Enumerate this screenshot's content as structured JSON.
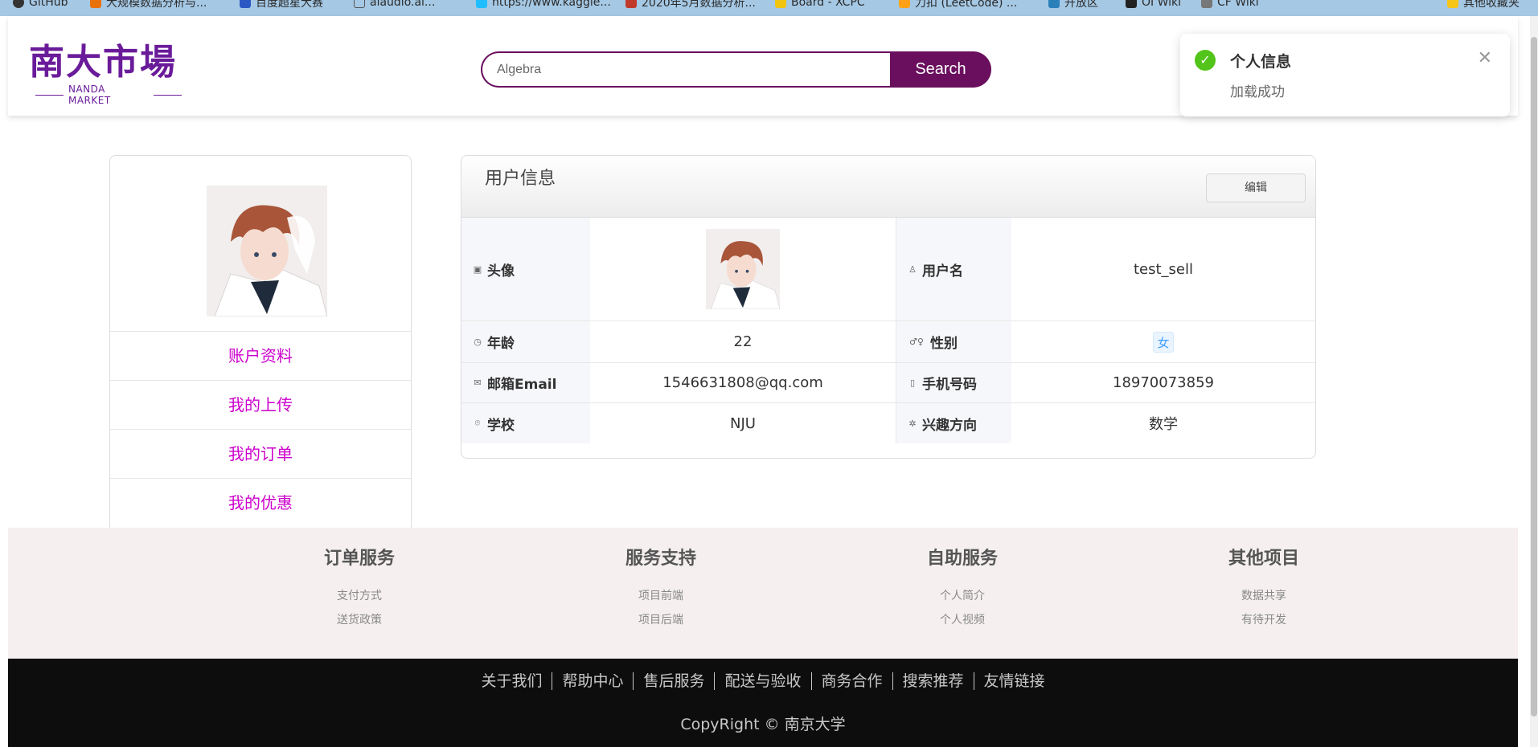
{
  "bookmarks": [
    {
      "label": "GitHub",
      "color": "#333333"
    },
    {
      "label": "大规模数据分析与...",
      "color": "#e8710a"
    },
    {
      "label": "百度超星大赛",
      "color": "#2b59c3"
    },
    {
      "label": "aiaudio.ai...",
      "color": "#555555"
    },
    {
      "label": "https://www.kaggle...",
      "color": "#20beff"
    },
    {
      "label": "2020年5月数据分析...",
      "color": "#c0392b"
    },
    {
      "label": "Board - XCPC",
      "color": "#f1c40f"
    },
    {
      "label": "力扣 (LeetCode) ...",
      "color": "#ffa116"
    },
    {
      "label": "开放区",
      "color": "#2980b9"
    },
    {
      "label": "OI Wiki",
      "color": "#222222"
    },
    {
      "label": "CF Wiki",
      "color": "#777777"
    },
    {
      "label": "其他收藏夹",
      "color": "#f5c518"
    }
  ],
  "header": {
    "logo_main": "南大市場",
    "logo_sub": "NANDA MARKET",
    "search_value": "Algebra",
    "search_button": "Search"
  },
  "notification": {
    "title": "个人信息",
    "message": "加载成功",
    "check_icon": "✓",
    "close_icon": "✕"
  },
  "sidebar": {
    "items": [
      "账户资料",
      "我的上传",
      "我的订单",
      "我的优惠"
    ]
  },
  "user_card": {
    "title": "用户信息",
    "edit_button": "编辑",
    "fields": {
      "avatar_label": "头像",
      "username_label": "用户名",
      "username": "test_sell",
      "age_label": "年龄",
      "age": "22",
      "gender_label": "性别",
      "gender": "女",
      "email_label": "邮箱Email",
      "email": "1546631808@qq.com",
      "phone_label": "手机号码",
      "phone": "18970073859",
      "school_label": "学校",
      "school": "NJU",
      "interest_label": "兴趣方向",
      "interest": "数学"
    }
  },
  "footer": {
    "columns": [
      {
        "title": "订单服务",
        "links": [
          "支付方式",
          "送货政策"
        ]
      },
      {
        "title": "服务支持",
        "links": [
          "项目前端",
          "项目后端"
        ]
      },
      {
        "title": "自助服务",
        "links": [
          "个人简介",
          "个人视频"
        ]
      },
      {
        "title": "其他项目",
        "links": [
          "数据共享",
          "有待开发"
        ]
      }
    ],
    "bottom_links": [
      "关于我们",
      "帮助中心",
      "售后服务",
      "配送与验收",
      "商务合作",
      "搜索推荐",
      "友情链接"
    ],
    "copyright": "CopyRight © 南京大学"
  },
  "colors": {
    "brand": "#6a0f5e",
    "sidebar_link": "#cc00cc",
    "success": "#52c41a"
  }
}
